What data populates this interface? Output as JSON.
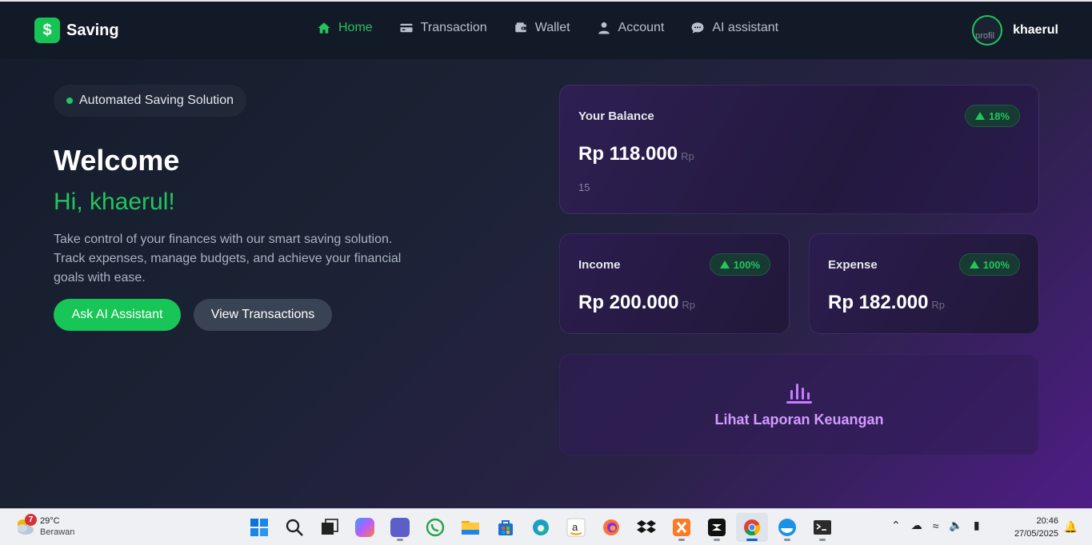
{
  "brand": {
    "name": "Saving",
    "logo_symbol": "$",
    "accent": "#22c55e"
  },
  "nav": {
    "items": [
      {
        "label": "Home",
        "icon": "home-icon",
        "active": true
      },
      {
        "label": "Transaction",
        "icon": "card-icon",
        "active": false
      },
      {
        "label": "Wallet",
        "icon": "wallet-icon",
        "active": false
      },
      {
        "label": "Account",
        "icon": "user-icon",
        "active": false
      },
      {
        "label": "AI assistant",
        "icon": "chat-icon",
        "active": false
      }
    ]
  },
  "profile": {
    "name": "khaerul",
    "avatar_alt": "profil"
  },
  "hero": {
    "badge": "Automated Saving Solution",
    "title": "Welcome",
    "greeting": "Hi, khaerul!",
    "description": "Take control of your finances with our smart saving solution. Track expenses, manage budgets, and achieve your financial goals with ease.",
    "primary_button": "Ask AI Assistant",
    "secondary_button": "View Transactions"
  },
  "cards": {
    "balance": {
      "label": "Your Balance",
      "amount": "Rp 118.000",
      "currency": "Rp",
      "change": "18%",
      "sub": "15"
    },
    "income": {
      "label": "Income",
      "amount": "Rp 200.000",
      "currency": "Rp",
      "change": "100%"
    },
    "expense": {
      "label": "Expense",
      "amount": "Rp 182.000",
      "currency": "Rp",
      "change": "100%"
    },
    "report": {
      "label": "Lihat Laporan Keuangan",
      "icon": "bar-chart-icon"
    }
  },
  "taskbar": {
    "weather": {
      "temp": "29°C",
      "condition": "Berawan",
      "badge": "7"
    },
    "apps": [
      "start-icon",
      "search-icon",
      "task-view-icon",
      "copilot-icon",
      "teams-icon",
      "whatsapp-icon",
      "file-explorer-icon",
      "store-icon",
      "edge-icon",
      "amazon-icon",
      "firefox-icon",
      "dropbox-icon",
      "xampp-icon",
      "capcut-icon",
      "chrome-icon",
      "docker-icon",
      "terminal-icon"
    ],
    "time": "20:46",
    "date": "27/05/2025"
  }
}
